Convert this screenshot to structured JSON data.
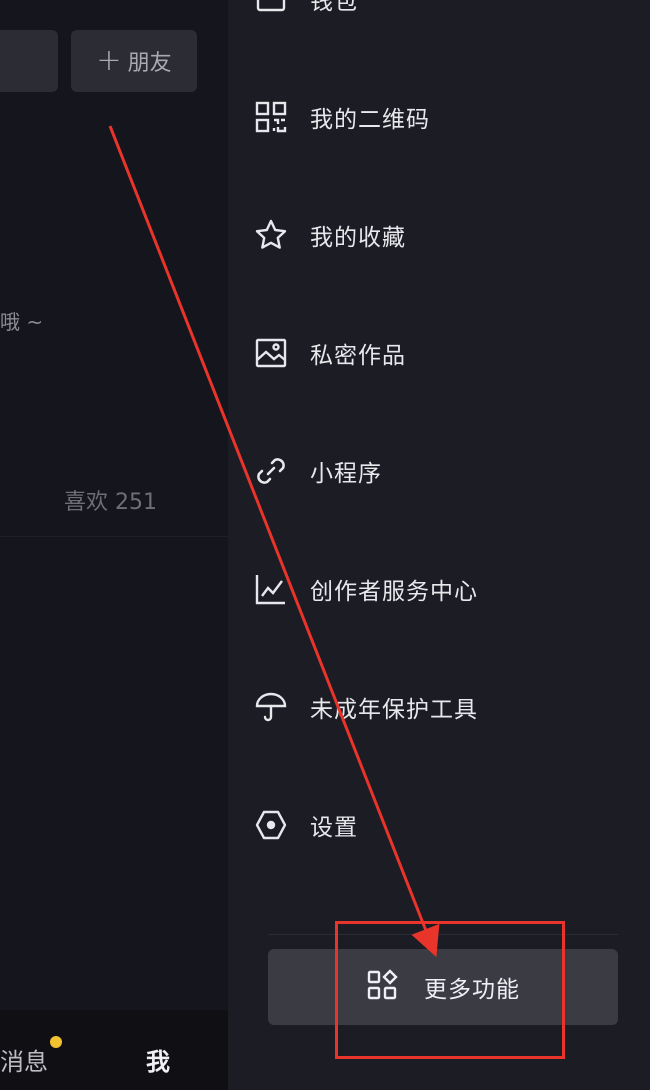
{
  "profile": {
    "add_friend_label": "朋友",
    "bio_fragment": "哦 ~",
    "likes_label": "喜欢",
    "likes_count": "251"
  },
  "bottom_nav": {
    "messages_label": "消息",
    "me_label": "我"
  },
  "drawer": {
    "wallet_label": "钱包",
    "items": [
      {
        "label": "我的二维码",
        "icon": "qr-code-icon"
      },
      {
        "label": "我的收藏",
        "icon": "star-icon"
      },
      {
        "label": "私密作品",
        "icon": "image-icon"
      },
      {
        "label": "小程序",
        "icon": "link-icon"
      },
      {
        "label": "创作者服务中心",
        "icon": "chart-icon"
      },
      {
        "label": "未成年保护工具",
        "icon": "umbrella-icon"
      },
      {
        "label": "设置",
        "icon": "settings-icon"
      }
    ],
    "more_label": "更多功能",
    "more_icon": "grid-icon"
  },
  "annotation": {
    "color": "#e8342a"
  }
}
